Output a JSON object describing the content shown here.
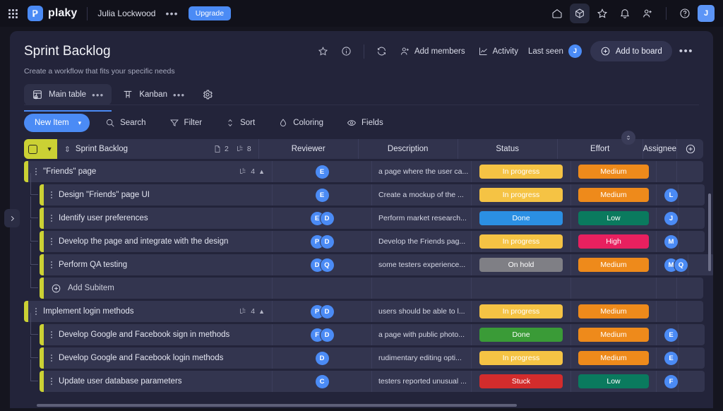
{
  "topnav": {
    "apps_icon": "apps-grid-icon",
    "logo_text": "plaky",
    "username": "Julia Lockwood",
    "dots": "•••",
    "upgrade_label": "Upgrade",
    "icons": [
      {
        "name": "home-icon",
        "active": false
      },
      {
        "name": "board-cube-icon",
        "active": true
      },
      {
        "name": "star-icon",
        "active": false
      },
      {
        "name": "bell-icon",
        "active": false
      },
      {
        "name": "add-person-icon",
        "active": false
      }
    ],
    "help_icon": "help-circle-icon",
    "avatar_initial": "J"
  },
  "board": {
    "title": "Sprint Backlog",
    "subtitle": "Create a workflow that fits your specific needs",
    "actions": {
      "star": "star-icon",
      "info": "info-icon",
      "refresh": "sync-icon",
      "add_members_label": "Add members",
      "activity_label": "Activity",
      "last_seen_label": "Last seen",
      "last_seen_initial": "J",
      "add_to_board_label": "Add to board",
      "more_dots": "•••"
    },
    "views": [
      {
        "label": "Main table",
        "icon": "table-home-icon",
        "dots": "•••",
        "active": true
      },
      {
        "label": "Kanban",
        "icon": "kanban-icon",
        "dots": "•••",
        "active": false
      }
    ],
    "settings_icon": "gear-icon",
    "toolbar": {
      "new_item_label": "New Item",
      "new_item_caret": "▾",
      "buttons": [
        {
          "label": "Search",
          "icon": "search-icon"
        },
        {
          "label": "Filter",
          "icon": "filter-icon"
        },
        {
          "label": "Sort",
          "icon": "sort-icon"
        },
        {
          "label": "Coloring",
          "icon": "droplet-icon"
        },
        {
          "label": "Fields",
          "icon": "eye-icon"
        }
      ]
    }
  },
  "table": {
    "group_color": "#cbd134",
    "group_name": "Sprint Backlog",
    "doc_count": "2",
    "subitem_count": "8",
    "columns": [
      "Reviewer",
      "Description",
      "Status",
      "Effort",
      "Assignee"
    ],
    "add_column_icon": "plus-circle-icon",
    "sort_chip_icon": "sort-updown-icon",
    "add_subitem_label": "Add Subitem",
    "rows": [
      {
        "type": "parent",
        "name": "\"Friends\" page",
        "sub_count": "4",
        "reviewer": [
          "E"
        ],
        "description": "a page where the user ca...",
        "status": {
          "label": "In progress",
          "color": "#f5c344"
        },
        "effort": {
          "label": "Medium",
          "color": "#ee8a1b"
        },
        "assignee": []
      },
      {
        "type": "child",
        "name": "Design \"Friends\" page UI",
        "reviewer": [
          "E"
        ],
        "description": "Create a mockup of the ...",
        "status": {
          "label": "In progress",
          "color": "#f5c344"
        },
        "effort": {
          "label": "Medium",
          "color": "#ee8a1b"
        },
        "assignee": [
          "L"
        ]
      },
      {
        "type": "child",
        "name": "Identify user preferences",
        "reviewer": [
          "E",
          "D"
        ],
        "description": "Perform market research...",
        "status": {
          "label": "Done",
          "color": "#2b8fe3"
        },
        "effort": {
          "label": "Low",
          "color": "#0a7a5e"
        },
        "assignee": [
          "J"
        ]
      },
      {
        "type": "child",
        "name": "Develop the page and integrate with the design",
        "reviewer": [
          "P",
          "D"
        ],
        "description": "Develop the Friends pag...",
        "status": {
          "label": "In progress",
          "color": "#f5c344"
        },
        "effort": {
          "label": "High",
          "color": "#e8205f"
        },
        "assignee": [
          "M"
        ]
      },
      {
        "type": "child",
        "name": "Perform QA testing",
        "reviewer": [
          "D",
          "Q"
        ],
        "description": "some testers experience...",
        "status": {
          "label": "On hold",
          "color": "#7f7f85"
        },
        "effort": {
          "label": "Medium",
          "color": "#ee8a1b"
        },
        "assignee": [
          "M",
          "Q"
        ]
      },
      {
        "type": "addsub"
      },
      {
        "type": "parent",
        "name": "Implement login methods",
        "sub_count": "4",
        "reviewer": [
          "P",
          "D"
        ],
        "description": "users should be able to l...",
        "status": {
          "label": "In progress",
          "color": "#f5c344"
        },
        "effort": {
          "label": "Medium",
          "color": "#ee8a1b"
        },
        "assignee": []
      },
      {
        "type": "child",
        "name": "Develop Google and Facebook sign in methods",
        "reviewer": [
          "F",
          "D"
        ],
        "description": "a page with public photo...",
        "status": {
          "label": "Done",
          "color": "#3a9b37"
        },
        "effort": {
          "label": "Medium",
          "color": "#ee8a1b"
        },
        "assignee": [
          "E"
        ]
      },
      {
        "type": "child",
        "name": "Develop Google and Facebook login methods",
        "reviewer": [
          "D"
        ],
        "description": "rudimentary editing opti...",
        "status": {
          "label": "In progress",
          "color": "#f5c344"
        },
        "effort": {
          "label": "Medium",
          "color": "#ee8a1b"
        },
        "assignee": [
          "E"
        ]
      },
      {
        "type": "child",
        "name": "Update user database parameters",
        "reviewer": [
          "C"
        ],
        "description": "testers reported unusual ...",
        "status": {
          "label": "Stuck",
          "color": "#d32c2c"
        },
        "effort": {
          "label": "Low",
          "color": "#0a7a5e"
        },
        "assignee": [
          "F"
        ]
      }
    ]
  },
  "collapse_tab_icon": "chevron-right-icon"
}
